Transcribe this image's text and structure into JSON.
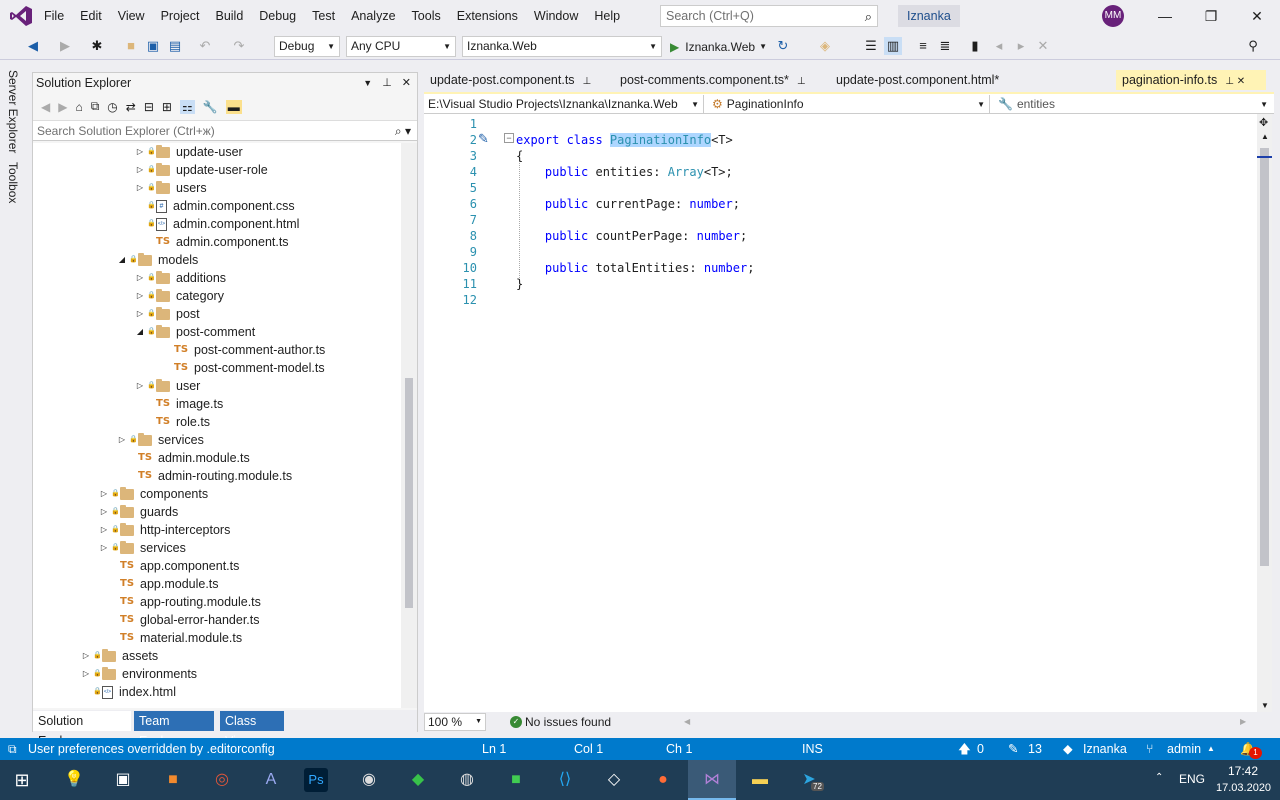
{
  "menu": {
    "items": [
      "File",
      "Edit",
      "View",
      "Project",
      "Build",
      "Debug",
      "Test",
      "Analyze",
      "Tools",
      "Extensions",
      "Window",
      "Help"
    ],
    "search_placeholder": "Search (Ctrl+Q)",
    "solution_name": "Iznanka",
    "user_initials": "MM"
  },
  "toolbar": {
    "config": "Debug",
    "platform": "Any CPU",
    "startup_project": "Iznanka.Web",
    "run_label": "Iznanka.Web"
  },
  "left_strip": {
    "server_explorer": "Server Explorer",
    "toolbox": "Toolbox"
  },
  "solution_explorer": {
    "title": "Solution Explorer",
    "search_placeholder": "Search Solution Explorer (Ctrl+ж)",
    "tree": [
      {
        "label": "update-user",
        "kind": "folder",
        "depth": 2,
        "expand": "collapsed"
      },
      {
        "label": "update-user-role",
        "kind": "folder",
        "depth": 2,
        "expand": "collapsed"
      },
      {
        "label": "users",
        "kind": "folder",
        "depth": 2,
        "expand": "collapsed"
      },
      {
        "label": "admin.component.css",
        "kind": "css",
        "depth": 2,
        "expand": "none"
      },
      {
        "label": "admin.component.html",
        "kind": "html",
        "depth": 2,
        "expand": "none"
      },
      {
        "label": "admin.component.ts",
        "kind": "ts",
        "depth": 2,
        "expand": "none"
      },
      {
        "label": "models",
        "kind": "folder",
        "depth": 1,
        "expand": "expanded"
      },
      {
        "label": "additions",
        "kind": "folder",
        "depth": 2,
        "expand": "collapsed"
      },
      {
        "label": "category",
        "kind": "folder",
        "depth": 2,
        "expand": "collapsed"
      },
      {
        "label": "post",
        "kind": "folder",
        "depth": 2,
        "expand": "collapsed"
      },
      {
        "label": "post-comment",
        "kind": "folder",
        "depth": 2,
        "expand": "expanded"
      },
      {
        "label": "post-comment-author.ts",
        "kind": "ts",
        "depth": 3,
        "expand": "none"
      },
      {
        "label": "post-comment-model.ts",
        "kind": "ts",
        "depth": 3,
        "expand": "none"
      },
      {
        "label": "user",
        "kind": "folder",
        "depth": 2,
        "expand": "collapsed"
      },
      {
        "label": "image.ts",
        "kind": "ts",
        "depth": 2,
        "expand": "none"
      },
      {
        "label": "role.ts",
        "kind": "ts",
        "depth": 2,
        "expand": "none"
      },
      {
        "label": "services",
        "kind": "folder",
        "depth": 1,
        "expand": "collapsed"
      },
      {
        "label": "admin.module.ts",
        "kind": "ts",
        "depth": 1,
        "expand": "none"
      },
      {
        "label": "admin-routing.module.ts",
        "kind": "ts",
        "depth": 1,
        "expand": "none"
      },
      {
        "label": "components",
        "kind": "folder",
        "depth": 0,
        "expand": "collapsed"
      },
      {
        "label": "guards",
        "kind": "folder",
        "depth": 0,
        "expand": "collapsed"
      },
      {
        "label": "http-interceptors",
        "kind": "folder",
        "depth": 0,
        "expand": "collapsed"
      },
      {
        "label": "services",
        "kind": "folder",
        "depth": 0,
        "expand": "collapsed"
      },
      {
        "label": "app.component.ts",
        "kind": "ts",
        "depth": 0,
        "expand": "none"
      },
      {
        "label": "app.module.ts",
        "kind": "ts",
        "depth": 0,
        "expand": "none"
      },
      {
        "label": "app-routing.module.ts",
        "kind": "ts",
        "depth": 0,
        "expand": "none"
      },
      {
        "label": "global-error-hander.ts",
        "kind": "ts",
        "depth": 0,
        "expand": "none"
      },
      {
        "label": "material.module.ts",
        "kind": "ts",
        "depth": 0,
        "expand": "none"
      },
      {
        "label": "assets",
        "kind": "folder",
        "depth": -1,
        "expand": "collapsed"
      },
      {
        "label": "environments",
        "kind": "folder",
        "depth": -1,
        "expand": "collapsed"
      },
      {
        "label": "index.html",
        "kind": "html",
        "depth": -1,
        "expand": "none"
      }
    ],
    "bottom_tabs": [
      "Solution Explorer",
      "Team Explorer",
      "Class View"
    ]
  },
  "doc_tabs": [
    {
      "label": "update-post.component.ts",
      "active": false
    },
    {
      "label": "post-comments.component.ts*",
      "active": false
    },
    {
      "label": "update-post.component.html*",
      "active": false
    },
    {
      "label": "pagination-info.ts",
      "active": true
    }
  ],
  "nav": {
    "project_path": "E:\\Visual Studio Projects\\Iznanka\\Iznanka.Web",
    "type": "PaginationInfo",
    "member": "entities"
  },
  "editor": {
    "line_numbers": [
      "1",
      "2",
      "3",
      "4",
      "5",
      "6",
      "7",
      "8",
      "9",
      "10",
      "11",
      "12"
    ],
    "lines": [
      {
        "n": 1,
        "parts": []
      },
      {
        "n": 2,
        "parts": [
          {
            "t": "export class ",
            "c": "kw"
          },
          {
            "t": "PaginationInfo",
            "c": "hl ty"
          },
          {
            "t": "<T>",
            "c": ""
          }
        ]
      },
      {
        "n": 3,
        "parts": [
          {
            "t": "{",
            "c": ""
          }
        ]
      },
      {
        "n": 4,
        "parts": [
          {
            "t": "    public ",
            "c": "kw"
          },
          {
            "t": "entities: ",
            "c": ""
          },
          {
            "t": "Array",
            "c": "ty"
          },
          {
            "t": "<T>;",
            "c": ""
          }
        ]
      },
      {
        "n": 5,
        "parts": []
      },
      {
        "n": 6,
        "parts": [
          {
            "t": "    public ",
            "c": "kw"
          },
          {
            "t": "currentPage: ",
            "c": ""
          },
          {
            "t": "number",
            "c": "kw"
          },
          {
            "t": ";",
            "c": ""
          }
        ]
      },
      {
        "n": 7,
        "parts": []
      },
      {
        "n": 8,
        "parts": [
          {
            "t": "    public ",
            "c": "kw"
          },
          {
            "t": "countPerPage: ",
            "c": ""
          },
          {
            "t": "number",
            "c": "kw"
          },
          {
            "t": ";",
            "c": ""
          }
        ]
      },
      {
        "n": 9,
        "parts": []
      },
      {
        "n": 10,
        "parts": [
          {
            "t": "    public ",
            "c": "kw"
          },
          {
            "t": "totalEntities: ",
            "c": ""
          },
          {
            "t": "number",
            "c": "kw"
          },
          {
            "t": ";",
            "c": ""
          }
        ]
      },
      {
        "n": 11,
        "parts": [
          {
            "t": "}",
            "c": ""
          }
        ]
      },
      {
        "n": 12,
        "parts": []
      }
    ]
  },
  "editor_status": {
    "zoom": "100 %",
    "issues": "No issues found"
  },
  "statusbar": {
    "message": "User preferences overridden by .editorconfig",
    "ln": "Ln 1",
    "col": "Col 1",
    "ch": "Ch 1",
    "mode": "INS",
    "up_count": "0",
    "edit_count": "13",
    "repo": "Iznanka",
    "branch": "admin",
    "notifications": "1"
  },
  "taskbar": {
    "lang": "ENG",
    "time": "17:42",
    "date": "17.03.2020",
    "telegram_badge": "72"
  },
  "colors": {
    "accent": "#007acc",
    "vs_purple": "#68217a",
    "active_tab": "#fff3b5",
    "ts_icon": "#d17f27",
    "folder": "#dcb67a"
  }
}
